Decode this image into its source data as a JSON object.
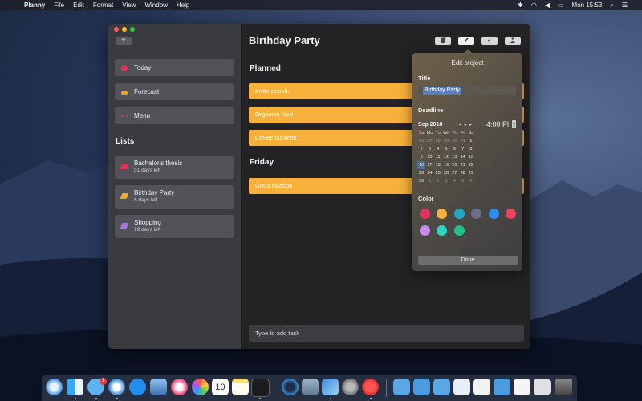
{
  "menubar": {
    "app": "Planny",
    "items": [
      "File",
      "Edit",
      "Format",
      "View",
      "Window",
      "Help"
    ],
    "clock": "Mon 15:53"
  },
  "sidebar": {
    "add_label": "+",
    "nav": [
      {
        "label": "Today",
        "color": "#e5325c"
      },
      {
        "label": "Forecast",
        "color": "#f5a623"
      },
      {
        "label": "Menu",
        "color": "#e5325c"
      }
    ],
    "lists_heading": "Lists",
    "lists": [
      {
        "name": "Bachelor's thesis",
        "sub": "51 days left",
        "color": "#e5325c"
      },
      {
        "name": "Birthday Party",
        "sub": "6 days left",
        "color": "#f5a623"
      },
      {
        "name": "Shopping",
        "sub": "19 days left",
        "color": "#a776e0"
      }
    ]
  },
  "main": {
    "title": "Birthday Party",
    "toolbar": {
      "check": "✓"
    },
    "sections": [
      {
        "heading": "Planned",
        "tasks": [
          "Invite people",
          "Organize food",
          "Create playlists"
        ]
      },
      {
        "heading": "Friday",
        "tasks": [
          "Get a location"
        ]
      }
    ],
    "add_task_placeholder": "Type to add task",
    "task_color": "#f7b13a"
  },
  "popover": {
    "heading": "Edit project",
    "title_label": "Title",
    "title_value": "Birthday Party",
    "deadline_label": "Deadline",
    "month": "Sep 2018",
    "time": "4:00 Pl",
    "weekdays": [
      "Su",
      "Mo",
      "Tu",
      "We",
      "Th",
      "Fr",
      "Sa"
    ],
    "weeks": [
      [
        "26",
        "27",
        "28",
        "29",
        "30",
        "31",
        "1"
      ],
      [
        "2",
        "3",
        "4",
        "5",
        "6",
        "7",
        "8"
      ],
      [
        "9",
        "10",
        "11",
        "12",
        "13",
        "14",
        "15"
      ],
      [
        "16",
        "17",
        "18",
        "19",
        "20",
        "21",
        "22"
      ],
      [
        "23",
        "24",
        "25",
        "26",
        "27",
        "28",
        "29"
      ],
      [
        "30",
        "1",
        "2",
        "3",
        "4",
        "5",
        "6"
      ]
    ],
    "selected_day": "16",
    "color_label": "Color",
    "colors": [
      "#e5325c",
      "#f5b041",
      "#22a8c4",
      "#6f6d8a",
      "#2a8ff0",
      "#e84560",
      "#c58af0",
      "#2bd4c0",
      "#22c38a"
    ],
    "selected_color": "#f5b041",
    "done_label": "Done"
  },
  "dock": {
    "messages_badge": "1",
    "calendar_day": "10"
  }
}
